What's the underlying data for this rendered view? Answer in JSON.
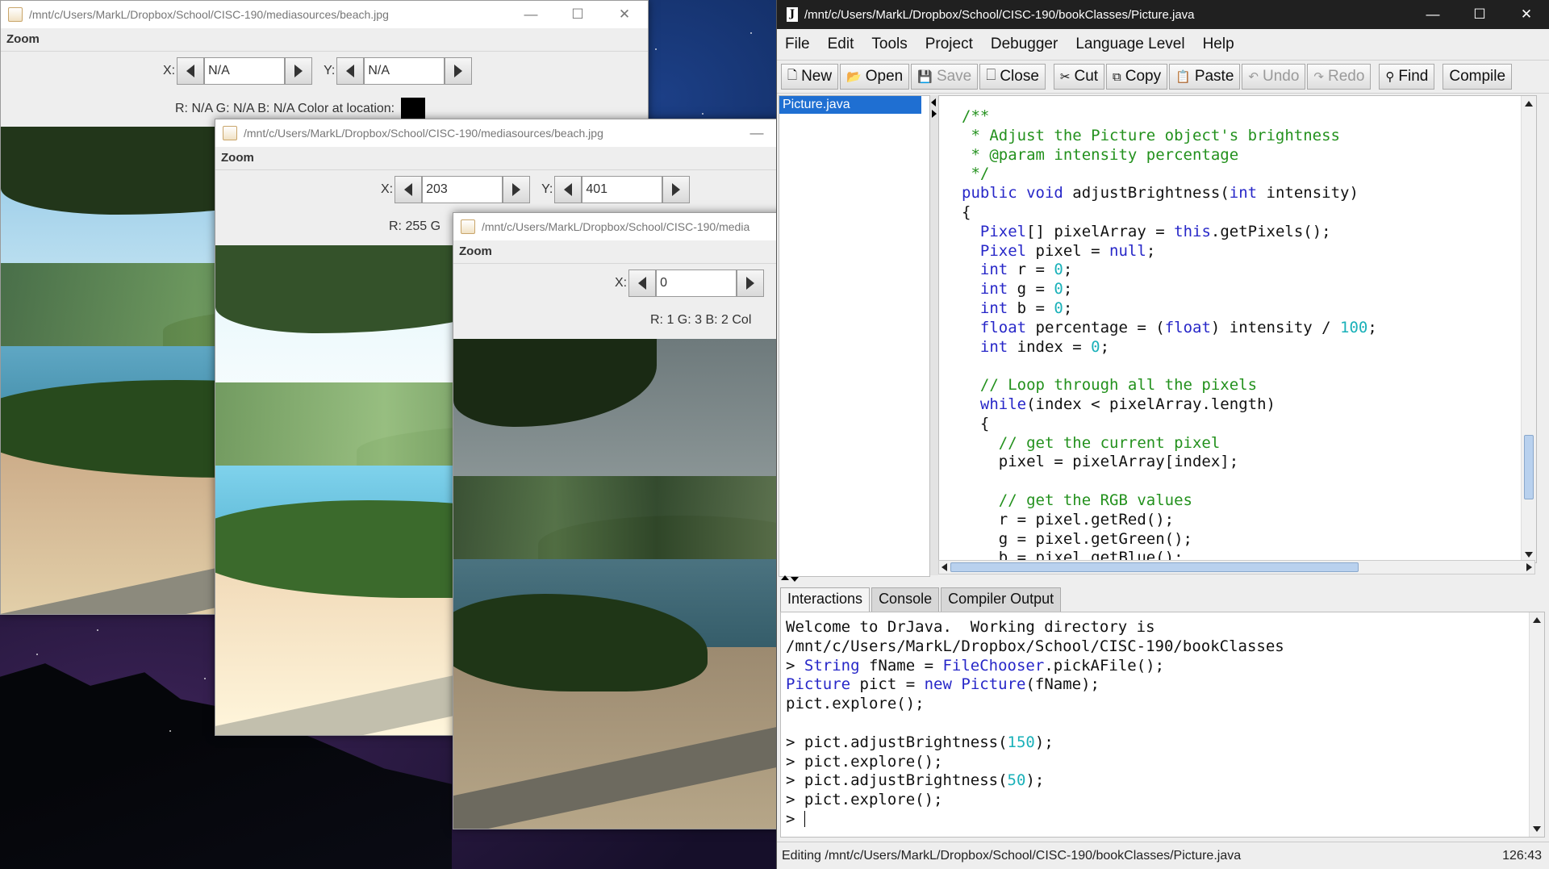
{
  "colors": {
    "editor_keyword": "#2727c8",
    "editor_comment": "#23911d",
    "editor_number": "#1ab1b9",
    "selection": "#1f6fd2"
  },
  "explorer_windows": [
    {
      "title": "/mnt/c/Users/MarkL/Dropbox/School/CISC-190/mediasources/beach.jpg",
      "zoom": "Zoom",
      "x_label": "X:",
      "x_value": "N/A",
      "y_label": "Y:",
      "y_value": "N/A",
      "rgb_text": "R: N/A G: N/A B: N/A Color at location:"
    },
    {
      "title": "/mnt/c/Users/MarkL/Dropbox/School/CISC-190/mediasources/beach.jpg",
      "zoom": "Zoom",
      "x_label": "X:",
      "x_value": "203",
      "y_label": "Y:",
      "y_value": "401",
      "rgb_text": "R: 255 G"
    },
    {
      "title": "/mnt/c/Users/MarkL/Dropbox/School/CISC-190/media",
      "zoom": "Zoom",
      "x_label": "X:",
      "x_value": "0",
      "rgb_text": "R: 1 G: 3 B: 2 Col"
    }
  ],
  "drjava": {
    "title": "/mnt/c/Users/MarkL/Dropbox/School/CISC-190/bookClasses/Picture.java",
    "menu": [
      "File",
      "Edit",
      "Tools",
      "Project",
      "Debugger",
      "Language Level",
      "Help"
    ],
    "toolbar": [
      {
        "label": "New",
        "icon": "new-file-icon",
        "enabled": true
      },
      {
        "label": "Open",
        "icon": "open-folder-icon",
        "enabled": true
      },
      {
        "label": "Save",
        "icon": "save-icon",
        "enabled": false
      },
      {
        "label": "Close",
        "icon": "close-doc-icon",
        "enabled": true
      },
      {
        "label": "Cut",
        "icon": "scissors-icon",
        "enabled": true
      },
      {
        "label": "Copy",
        "icon": "copy-icon",
        "enabled": true
      },
      {
        "label": "Paste",
        "icon": "clipboard-icon",
        "enabled": true
      },
      {
        "label": "Undo",
        "icon": "undo-icon",
        "enabled": false
      },
      {
        "label": "Redo",
        "icon": "redo-icon",
        "enabled": false
      },
      {
        "label": "Find",
        "icon": "binoculars-icon",
        "enabled": true
      },
      {
        "label": "Compile",
        "icon": "compile-icon",
        "enabled": true
      }
    ],
    "open_file": "Picture.java",
    "code_lines": [
      [
        [
          "cm",
          "/**"
        ]
      ],
      [
        [
          "cm",
          " * Adjust the Picture object's brightness"
        ]
      ],
      [
        [
          "cm",
          " * @param intensity percentage"
        ]
      ],
      [
        [
          "cm",
          " */"
        ]
      ],
      [
        [
          "kw",
          "public"
        ],
        [
          "t",
          " "
        ],
        [
          "kw",
          "void"
        ],
        [
          "t",
          " adjustBrightness("
        ],
        [
          "kw",
          "int"
        ],
        [
          "t",
          " intensity)"
        ]
      ],
      [
        [
          "t",
          "{"
        ]
      ],
      [
        [
          "t",
          "  "
        ],
        [
          "kw",
          "Pixel"
        ],
        [
          "t",
          "[] pixelArray = "
        ],
        [
          "kw",
          "this"
        ],
        [
          "t",
          ".getPixels();"
        ]
      ],
      [
        [
          "t",
          "  "
        ],
        [
          "kw",
          "Pixel"
        ],
        [
          "t",
          " pixel = "
        ],
        [
          "kw",
          "null"
        ],
        [
          "t",
          ";"
        ]
      ],
      [
        [
          "t",
          "  "
        ],
        [
          "kw",
          "int"
        ],
        [
          "t",
          " r = "
        ],
        [
          "nm",
          "0"
        ],
        [
          "t",
          ";"
        ]
      ],
      [
        [
          "t",
          "  "
        ],
        [
          "kw",
          "int"
        ],
        [
          "t",
          " g = "
        ],
        [
          "nm",
          "0"
        ],
        [
          "t",
          ";"
        ]
      ],
      [
        [
          "t",
          "  "
        ],
        [
          "kw",
          "int"
        ],
        [
          "t",
          " b = "
        ],
        [
          "nm",
          "0"
        ],
        [
          "t",
          ";"
        ]
      ],
      [
        [
          "t",
          "  "
        ],
        [
          "kw",
          "float"
        ],
        [
          "t",
          " percentage = ("
        ],
        [
          "kw",
          "float"
        ],
        [
          "t",
          ") intensity / "
        ],
        [
          "nm",
          "100"
        ],
        [
          "t",
          ";"
        ]
      ],
      [
        [
          "t",
          "  "
        ],
        [
          "kw",
          "int"
        ],
        [
          "t",
          " index = "
        ],
        [
          "nm",
          "0"
        ],
        [
          "t",
          ";"
        ]
      ],
      [
        [
          "t",
          ""
        ]
      ],
      [
        [
          "t",
          "  "
        ],
        [
          "cm",
          "// Loop through all the pixels"
        ]
      ],
      [
        [
          "t",
          "  "
        ],
        [
          "kw",
          "while"
        ],
        [
          "t",
          "(index < pixelArray.length)"
        ]
      ],
      [
        [
          "t",
          "  {"
        ]
      ],
      [
        [
          "t",
          "    "
        ],
        [
          "cm",
          "// get the current pixel"
        ]
      ],
      [
        [
          "t",
          "    pixel = pixelArray[index];"
        ]
      ],
      [
        [
          "t",
          ""
        ]
      ],
      [
        [
          "t",
          "    "
        ],
        [
          "cm",
          "// get the RGB values"
        ]
      ],
      [
        [
          "t",
          "    r = pixel.getRed();"
        ]
      ],
      [
        [
          "t",
          "    g = pixel.getGreen();"
        ]
      ],
      [
        [
          "t",
          "    b = pixel.getBlue();"
        ]
      ]
    ],
    "tabs": [
      "Interactions",
      "Console",
      "Compiler Output"
    ],
    "console_lines": [
      [
        [
          "t",
          "Welcome to DrJava.  Working directory is"
        ]
      ],
      [
        [
          "t",
          "/mnt/c/Users/MarkL/Dropbox/School/CISC-190/bookClasses"
        ]
      ],
      [
        [
          "t",
          "> "
        ],
        [
          "kw",
          "String"
        ],
        [
          "t",
          " fName = "
        ],
        [
          "kw",
          "FileChooser"
        ],
        [
          "t",
          ".pickAFile();"
        ]
      ],
      [
        [
          "kw",
          "Picture"
        ],
        [
          "t",
          " pict = "
        ],
        [
          "kw",
          "new"
        ],
        [
          "t",
          " "
        ],
        [
          "kw",
          "Picture"
        ],
        [
          "t",
          "(fName);"
        ]
      ],
      [
        [
          "t",
          "pict.explore();"
        ]
      ],
      [
        [
          "t",
          ""
        ]
      ],
      [
        [
          "t",
          "> pict.adjustBrightness("
        ],
        [
          "nm",
          "150"
        ],
        [
          "t",
          ");"
        ]
      ],
      [
        [
          "t",
          "> pict.explore();"
        ]
      ],
      [
        [
          "t",
          "> pict.adjustBrightness("
        ],
        [
          "nm",
          "50"
        ],
        [
          "t",
          ");"
        ]
      ],
      [
        [
          "t",
          "> pict.explore();"
        ]
      ],
      [
        [
          "t",
          "> "
        ]
      ]
    ],
    "status_text": "Editing /mnt/c/Users/MarkL/Dropbox/School/CISC-190/bookClasses/Picture.java",
    "cursor_position": "126:43"
  }
}
